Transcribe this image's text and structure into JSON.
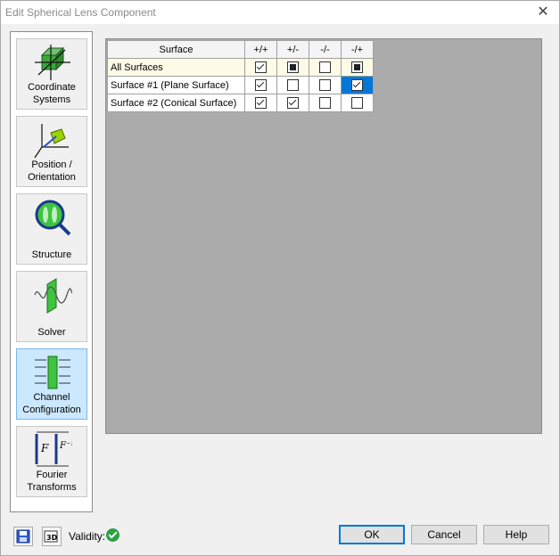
{
  "window": {
    "title": "Edit Spherical Lens Component",
    "close_glyph": "✕"
  },
  "sidebar": {
    "items": [
      {
        "label": "Coordinate\nSystems",
        "icon": "coordinate-systems-icon"
      },
      {
        "label": "Position /\nOrientation",
        "icon": "position-orientation-icon"
      },
      {
        "label": "Structure",
        "icon": "structure-icon"
      },
      {
        "label": "Solver",
        "icon": "solver-icon"
      },
      {
        "label": "Channel\nConfiguration",
        "icon": "channel-configuration-icon",
        "active": true
      },
      {
        "label": "Fourier\nTransforms",
        "icon": "fourier-transforms-icon"
      }
    ]
  },
  "table": {
    "headers": [
      "Surface",
      "+/+",
      "+/-",
      "-/-",
      "-/+"
    ],
    "rows": [
      {
        "name": "All Surfaces",
        "cells": [
          "checked",
          "indeterminate",
          "unchecked",
          "indeterminate"
        ]
      },
      {
        "name": "Surface #1 (Plane Surface)",
        "cells": [
          "checked",
          "unchecked",
          "unchecked",
          "checked"
        ],
        "selected_col": 3
      },
      {
        "name": "Surface #2 (Conical Surface)",
        "cells": [
          "checked",
          "checked",
          "unchecked",
          "unchecked"
        ]
      }
    ]
  },
  "footer": {
    "save_icon": "save-icon",
    "view3d_icon": "view-3d-icon",
    "validity_label": "Validity:",
    "validity_status": "valid",
    "ok_label": "OK",
    "cancel_label": "Cancel",
    "help_label": "Help"
  },
  "colors": {
    "accent": "#0078d7",
    "active_item": "#cce8ff",
    "content_bg": "#ababab",
    "valid": "#2ea043"
  }
}
